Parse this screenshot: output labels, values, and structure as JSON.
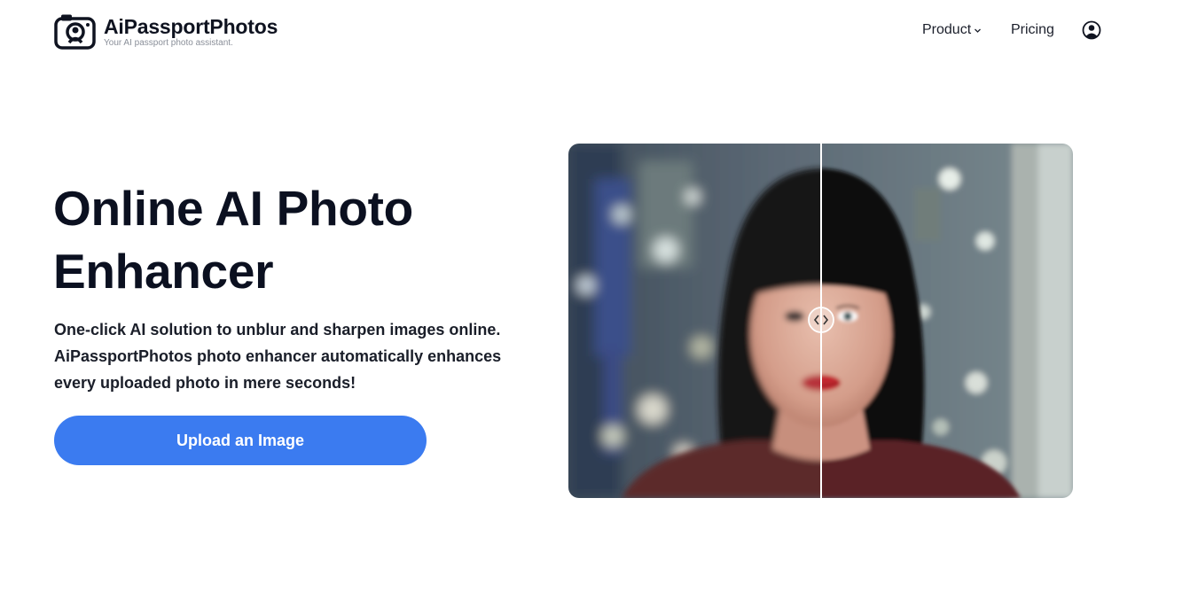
{
  "brand": {
    "name": "AiPassportPhotos",
    "tagline": "Your AI passport photo assistant."
  },
  "nav": {
    "product_label": "Product",
    "pricing_label": "Pricing"
  },
  "hero": {
    "title_line1": "Online AI Photo",
    "title_line2": "Enhancer",
    "description": "One-click AI solution to unblur and sharpen images online. AiPassportPhotos photo enhancer automatically enhances every uploaded photo in mere seconds!",
    "cta_label": "Upload an Image"
  },
  "comparison": {
    "divider_position": 0.5,
    "icons": [
      "chevron-left-icon",
      "chevron-right-icon"
    ]
  },
  "colors": {
    "primary": "#3b7bf0",
    "text": "#0b1020"
  }
}
